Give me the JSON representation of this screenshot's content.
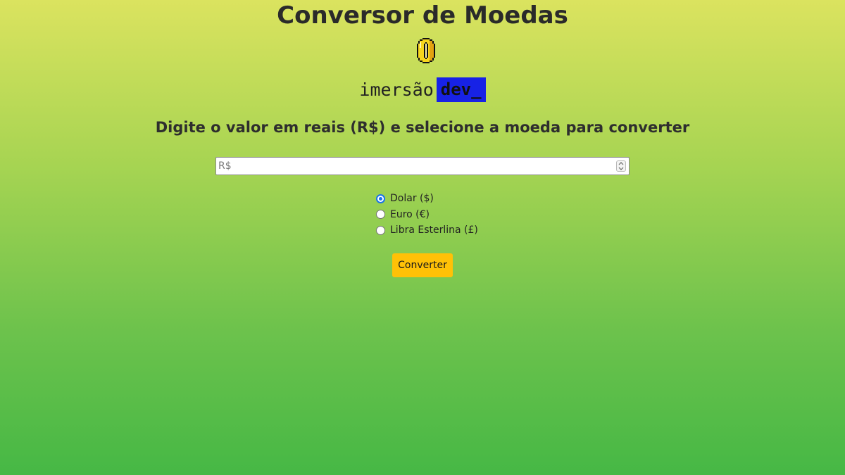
{
  "header": {
    "title": "Conversor de Moedas",
    "logo_icon": "coin-icon",
    "brand": {
      "word": "imersão",
      "highlight": "dev_",
      "highlight_bg": "#1722e6"
    }
  },
  "instructions": "Digite o valor em reais (R$) e selecione a moeda para converter",
  "amount_input": {
    "placeholder": "R$",
    "value": ""
  },
  "currency_options": [
    {
      "label": "Dolar ($)",
      "selected": true
    },
    {
      "label": "Euro (€)",
      "selected": false
    },
    {
      "label": "Libra Esterlina (£)",
      "selected": false
    }
  ],
  "convert_button": {
    "label": "Converter",
    "color": "#ffc107"
  },
  "colors": {
    "background_top": "#dbe35f",
    "background_bottom": "#46b845",
    "radio_accent": "#1a73e8"
  }
}
